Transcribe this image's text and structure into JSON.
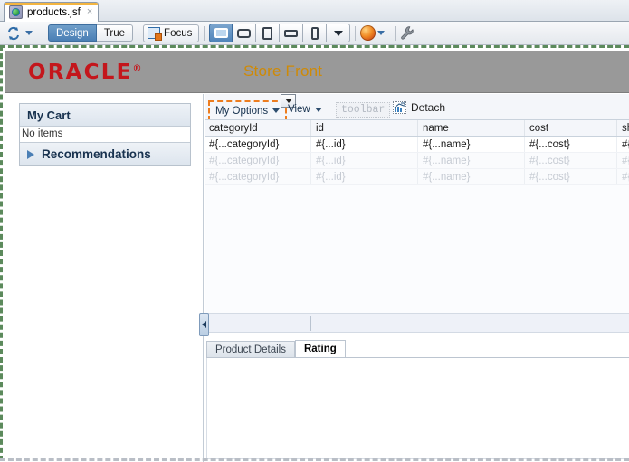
{
  "window": {
    "document_tab": {
      "label": "products.jsf",
      "icon": "jsf-page-globe-icon",
      "close_glyph": "×"
    }
  },
  "toolbar": {
    "refresh_icon": "refresh-sync-icon",
    "dropdown_caret": "▾",
    "view_modes": [
      {
        "label": "Design",
        "active": true
      },
      {
        "label": "True",
        "active": false
      }
    ],
    "focus_button": {
      "label": "Focus",
      "icon": "focus-frame-icon"
    },
    "device_buttons": [
      {
        "name": "desktop",
        "active": true
      },
      {
        "name": "tablet-landscape",
        "active": false
      },
      {
        "name": "tablet-portrait",
        "active": false
      },
      {
        "name": "handheld-landscape",
        "active": false
      },
      {
        "name": "phone-portrait",
        "active": false
      }
    ],
    "device_more_caret": "▾",
    "browser_preview": {
      "icon": "firefox-icon",
      "caret": "▾"
    },
    "settings_icon": "wrench-icon"
  },
  "banner": {
    "logo_text": "ORACLE",
    "logo_registered": "®",
    "logo_color": "#c4161c",
    "title": "Store Front",
    "title_color": "#cf8a06",
    "background_color": "#999999"
  },
  "left_panel": {
    "cart": {
      "header": "My Cart",
      "empty_text": "No items"
    },
    "recommendations": {
      "label": "Recommendations",
      "expander_icon": "triangle-right-icon"
    }
  },
  "panel_toolbar": {
    "my_options": {
      "label": "My Options",
      "caret": "▾",
      "selected": true,
      "selection_color": "#ed7d1f"
    },
    "view_menu": {
      "label": "View",
      "caret": "▾"
    },
    "overflow_button": {
      "icon": "chevron-down-icon"
    },
    "toolbar_placeholder": "toolbar",
    "detach": {
      "label": "Detach",
      "icon": "detach-chart-icon"
    }
  },
  "table": {
    "columns": [
      "categoryId",
      "id",
      "name",
      "cost",
      "shortDesc"
    ],
    "rows": [
      {
        "cells": [
          "#{...categoryId}",
          "#{...id}",
          "#{...name}",
          "#{...cost}",
          "#{...short"
        ],
        "ghost": false
      },
      {
        "cells": [
          "#{...categoryId}",
          "#{...id}",
          "#{...name}",
          "#{...cost}",
          "#{...short"
        ],
        "ghost": true
      },
      {
        "cells": [
          "#{...categoryId}",
          "#{...id}",
          "#{...name}",
          "#{...cost}",
          "#{...short"
        ],
        "ghost": true
      }
    ]
  },
  "splitter": {
    "collapse_icon": "triangle-left-icon"
  },
  "bottom_tabs": [
    {
      "label": "Product Details",
      "active": false
    },
    {
      "label": "Rating",
      "active": true
    }
  ]
}
